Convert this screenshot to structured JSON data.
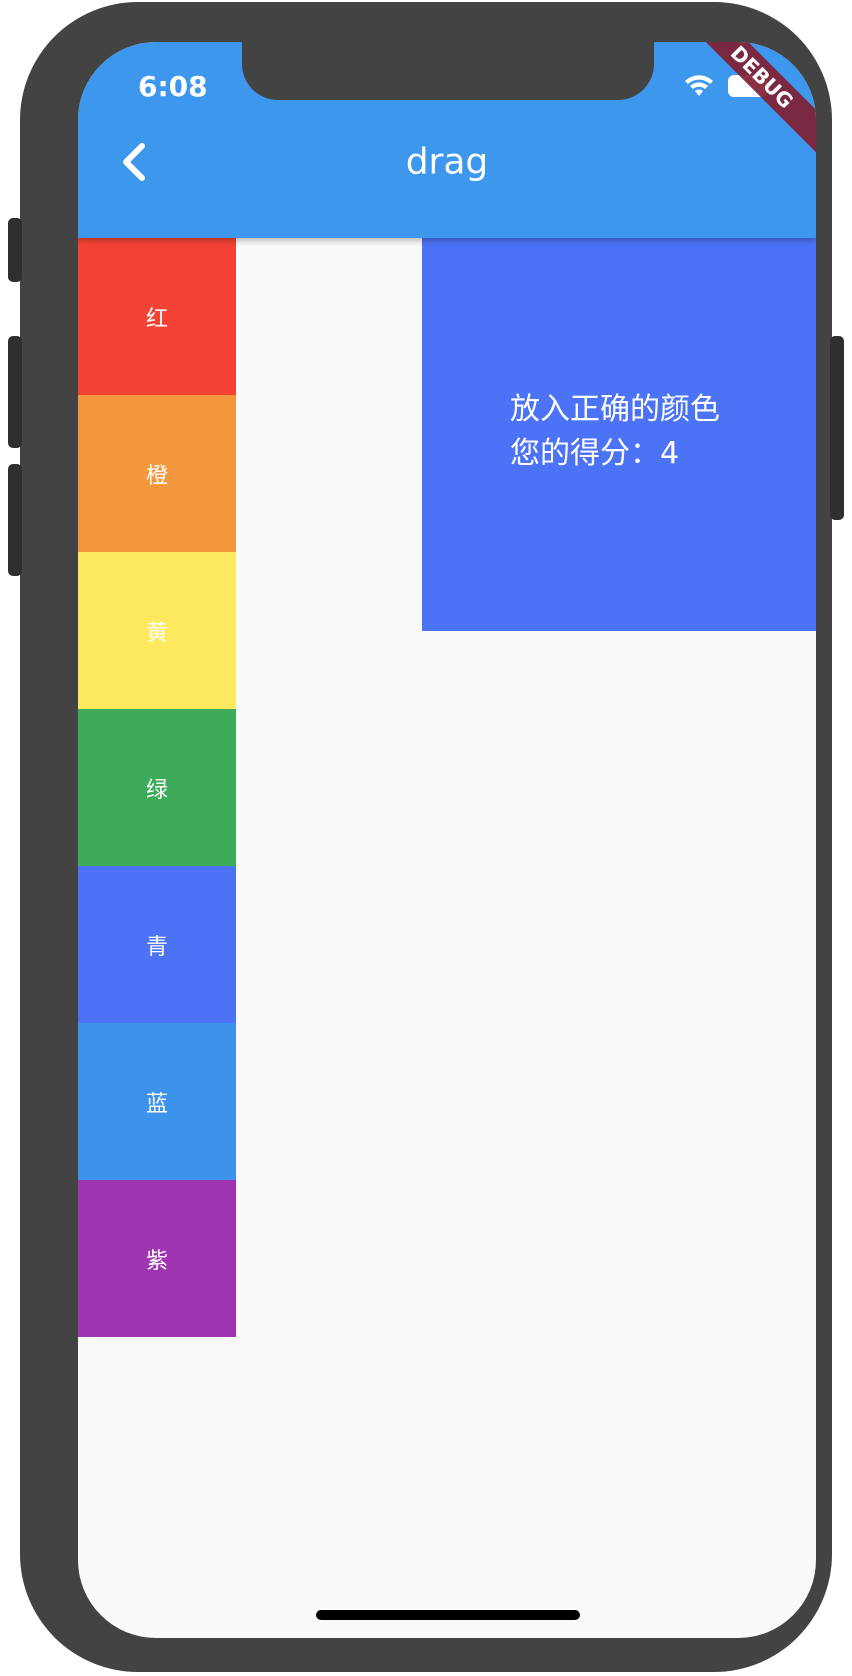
{
  "status_bar": {
    "time": "6:08"
  },
  "appbar": {
    "title": "drag",
    "color": "#3d97ed"
  },
  "debug_banner": "DEBUG",
  "icons": {
    "back": "chevron-left-icon",
    "wifi": "wifi-icon",
    "battery": "battery-icon"
  },
  "swatches": [
    {
      "label": "红",
      "color": "#f44336"
    },
    {
      "label": "橙",
      "color": "#f5973c"
    },
    {
      "label": "黄",
      "color": "#fde95f"
    },
    {
      "label": "绿",
      "color": "#3dab5a"
    },
    {
      "label": "青",
      "color": "#4c73f6"
    },
    {
      "label": "蓝",
      "color": "#3d93eb"
    },
    {
      "label": "紫",
      "color": "#9f35b2"
    }
  ],
  "target": {
    "color": "#4c73f6",
    "prompt": "放入正确的颜色",
    "score_label": "您的得分：",
    "score": "4"
  }
}
